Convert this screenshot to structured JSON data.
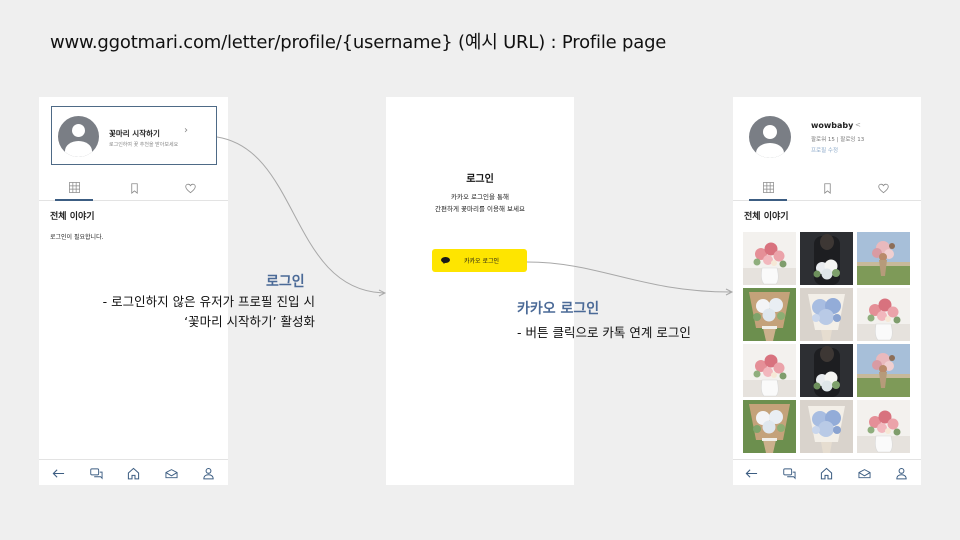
{
  "page": {
    "url_title": "www.ggotmari.com/letter/profile/{username} (예시 URL) : Profile page"
  },
  "screen_guest": {
    "start_card": {
      "title": "꽃마리 시작하기",
      "subtitle": "로그인하여 꽃 추천을 받아보세요"
    },
    "tabs": [
      {
        "icon": "grid-icon",
        "active": true
      },
      {
        "icon": "bookmark-icon",
        "active": false
      },
      {
        "icon": "heart-icon",
        "active": false
      }
    ],
    "section_title": "전체 이야기",
    "empty_message": "로그인이 필요합니다."
  },
  "screen_login": {
    "title": "로그인",
    "desc_line1": "카카오 로그인을 통해",
    "desc_line2": "간편하게 꽃마리를 이용해 보세요",
    "kakao_button": "카카오 로그인"
  },
  "screen_profile": {
    "username": "wowbaby",
    "follow_stats": "팔로워 15 | 팔로잉 13",
    "edit_link": "프로필 수정",
    "section_title": "전체 이야기",
    "photos": [
      "pink-roses-vase",
      "hands-holding-bouquet",
      "pink-bouquet-field",
      "wrapped-bouquet",
      "blue-hydrangea-bouquet",
      "pink-roses-vase",
      "pink-roses-vase",
      "hands-holding-bouquet",
      "pink-bouquet-field",
      "wrapped-bouquet",
      "blue-hydrangea-bouquet",
      "pink-roses-vase"
    ]
  },
  "bottom_nav": [
    "back-arrow-icon",
    "chat-icon",
    "home-icon",
    "letter-icon",
    "user-icon"
  ],
  "annotations": {
    "login": {
      "title": "로그인",
      "line1": "- 로그인하지 않은 유저가 프로필 진입 시",
      "line2": "‘꽃마리 시작하기’ 활성화"
    },
    "kakao": {
      "title": "카카오 로그인",
      "line1": "- 버튼 클릭으로 카톡 연계 로그인"
    }
  },
  "colors": {
    "background": "#efefef",
    "accent": "#3c5d82",
    "annotation_title": "#4b6a97",
    "kakao_yellow": "#fee500",
    "avatar_gray": "#7a7e85"
  }
}
